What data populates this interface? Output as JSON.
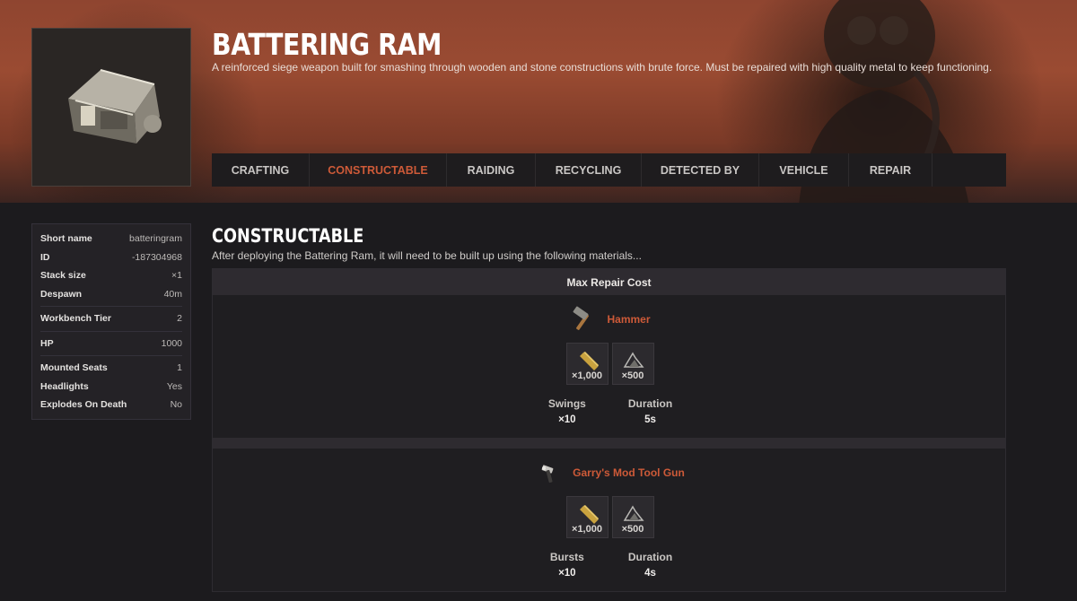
{
  "item": {
    "title": "Battering Ram",
    "description": "A reinforced siege weapon built for smashing through wooden and stone constructions with brute force. Must be repaired with high quality metal to keep functioning."
  },
  "tabs": [
    {
      "label": "CRAFTING",
      "active": false
    },
    {
      "label": "CONSTRUCTABLE",
      "active": true
    },
    {
      "label": "RAIDING",
      "active": false
    },
    {
      "label": "RECYCLING",
      "active": false
    },
    {
      "label": "DETECTED BY",
      "active": false
    },
    {
      "label": "VEHICLE",
      "active": false
    },
    {
      "label": "REPAIR",
      "active": false
    }
  ],
  "stats": [
    {
      "key": "Short name",
      "value": "batteringram"
    },
    {
      "key": "ID",
      "value": "-187304968"
    },
    {
      "key": "Stack size",
      "value": "×1"
    },
    {
      "key": "Despawn",
      "value": "40m"
    },
    {
      "key": "Workbench Tier",
      "value": "2"
    },
    {
      "key": "HP",
      "value": "1000"
    },
    {
      "key": "Mounted Seats",
      "value": "1"
    },
    {
      "key": "Headlights",
      "value": "Yes"
    },
    {
      "key": "Explodes On Death",
      "value": "No"
    }
  ],
  "section": {
    "title": "Constructable",
    "description": "After deploying the Battering Ram, it will need to be built up using the following materials...",
    "panel_header": "Max Repair Cost"
  },
  "tools": [
    {
      "name": "Hammer",
      "icon": "hammer-icon",
      "costs": [
        {
          "icon": "wood-icon",
          "amount": "×1,000"
        },
        {
          "icon": "metal-fragments-icon",
          "amount": "×500"
        }
      ],
      "metrics": [
        {
          "label": "Swings",
          "value": "×10"
        },
        {
          "label": "Duration",
          "value": "5s"
        }
      ]
    },
    {
      "name": "Garry's Mod Tool Gun",
      "icon": "tool-gun-icon",
      "costs": [
        {
          "icon": "wood-icon",
          "amount": "×1,000"
        },
        {
          "icon": "metal-fragments-icon",
          "amount": "×500"
        }
      ],
      "metrics": [
        {
          "label": "Bursts",
          "value": "×10"
        },
        {
          "label": "Duration",
          "value": "4s"
        }
      ]
    }
  ],
  "colors": {
    "accent": "#cd5a38",
    "hero": "#9a4b32",
    "background": "#1c1b1e"
  }
}
